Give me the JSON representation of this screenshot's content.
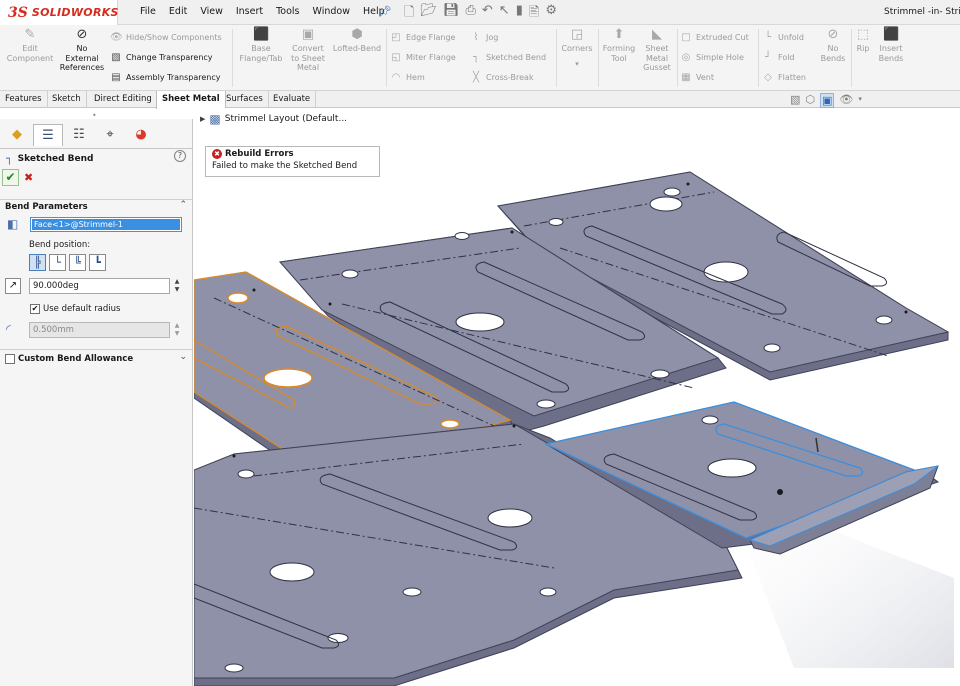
{
  "app": {
    "brand_mark": "3S",
    "brand_name": "SOLIDWORKS",
    "document_title": "Strimmel -in- Strimmel"
  },
  "menu": {
    "items": [
      "File",
      "Edit",
      "View",
      "Insert",
      "Tools",
      "Window",
      "Help"
    ]
  },
  "ribbon": {
    "edit_component": "Edit\nComponent",
    "no_external_references": "No\nExternal\nReferences",
    "hide_show_components": "Hide/Show Components",
    "change_transparency": "Change Transparency",
    "assembly_transparency": "Assembly Transparency",
    "base_flange_tab": "Base\nFlange/Tab",
    "convert_to_sheet_metal": "Convert\nto Sheet\nMetal",
    "lofted_bend": "Lofted-Bend",
    "edge_flange": "Edge Flange",
    "miter_flange": "Miter Flange",
    "hem": "Hem",
    "jog": "Jog",
    "sketched_bend": "Sketched Bend",
    "cross_break": "Cross-Break",
    "corners": "Corners",
    "forming_tool": "Forming\nTool",
    "sheet_metal_gusset": "Sheet\nMetal\nGusset",
    "extruded_cut": "Extruded Cut",
    "simple_hole": "Simple Hole",
    "vent": "Vent",
    "unfold": "Unfold",
    "fold": "Fold",
    "flatten": "Flatten",
    "no_bends": "No\nBends",
    "rip": "Rip",
    "insert_bends": "Insert\nBends"
  },
  "tabs": [
    "Features",
    "Sketch",
    "Direct Editing",
    "Sheet Metal",
    "Surfaces",
    "Evaluate"
  ],
  "active_tab": "Sheet Metal",
  "property_manager": {
    "title": "Sketched Bend",
    "bend_parameters_label": "Bend Parameters",
    "face_selection": "Face<1>@Strimmel-1",
    "bend_position_label": "Bend position:",
    "angle_value": "90.000deg",
    "use_default_radius_label": "Use default radius",
    "use_default_radius_checked": true,
    "radius_value": "0.500mm",
    "custom_bend_allowance_label": "Custom Bend Allowance",
    "custom_bend_allowance_checked": false
  },
  "feature_tree": {
    "item": "Strimmel Layout  (Default..."
  },
  "error_popup": {
    "title": "Rebuild Errors",
    "message": "Failed to make the Sketched Bend"
  },
  "colors": {
    "accent": "#d52b1e",
    "plate": "#8d8fa6",
    "plate_edge": "#44475a",
    "highlight_orange": "#d98a2a",
    "highlight_blue": "#3a8fe0"
  }
}
